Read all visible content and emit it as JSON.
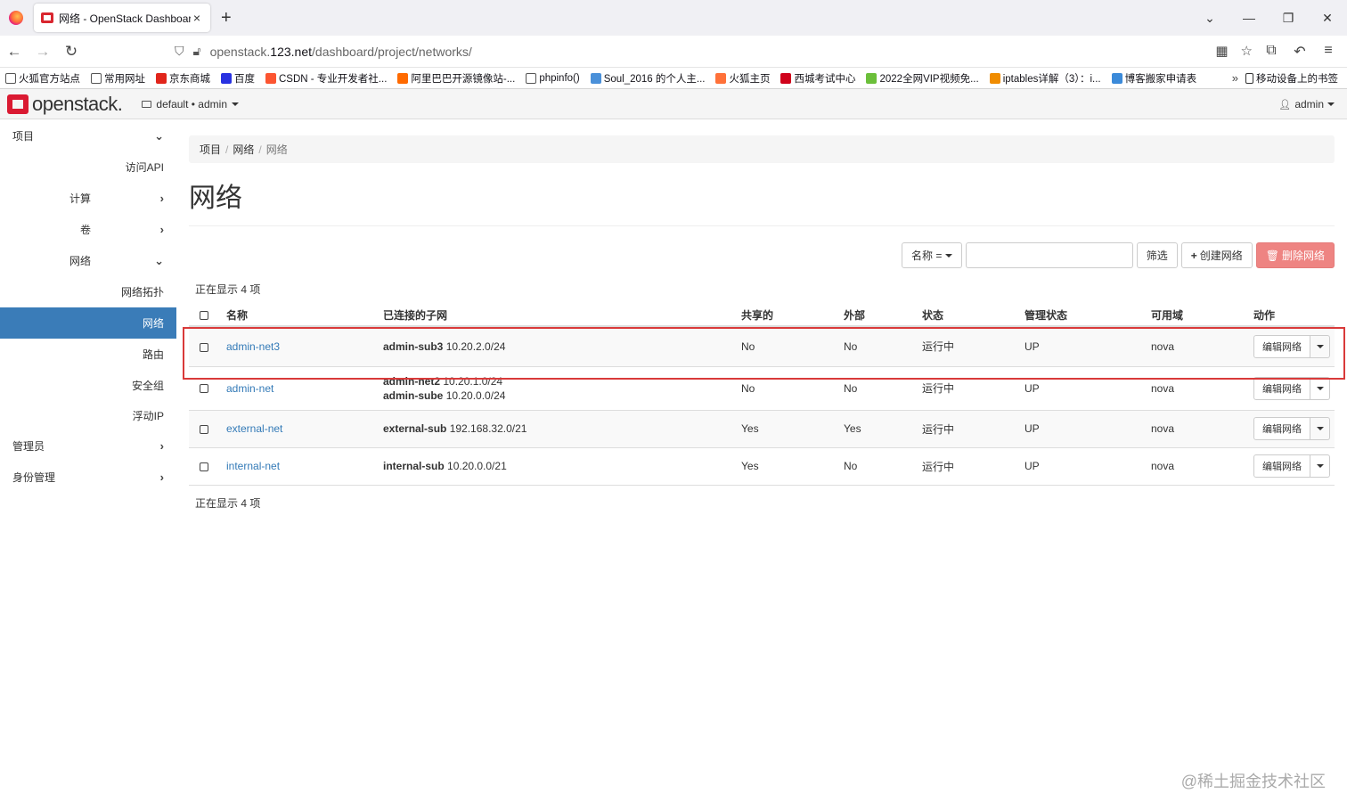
{
  "browser": {
    "tab_title": "网络 - OpenStack Dashboard",
    "url_prefix": "openstack.",
    "url_domain": "123.net",
    "url_path": "/dashboard/project/networks/"
  },
  "bookmarks": [
    {
      "label": "火狐官方站点",
      "color": "#ffffff"
    },
    {
      "label": "常用网址",
      "color": "#ffffff"
    },
    {
      "label": "京东商城",
      "color": "#e1251b"
    },
    {
      "label": "百度",
      "color": "#2932e1"
    },
    {
      "label": "CSDN - 专业开发者社...",
      "color": "#fc5531"
    },
    {
      "label": "阿里巴巴开源镜像站-...",
      "color": "#ff6a00"
    },
    {
      "label": "phpinfo()",
      "color": "#ffffff"
    },
    {
      "label": "Soul_2016 的个人主...",
      "color": "#4a90d9"
    },
    {
      "label": "火狐主页",
      "color": "#ff7139"
    },
    {
      "label": "西城考试中心",
      "color": "#d0021b"
    },
    {
      "label": "2022全网VIP视频免...",
      "color": "#6bbf3a"
    },
    {
      "label": "iptables详解（3）：i...",
      "color": "#f08c00"
    },
    {
      "label": "博客搬家申请表",
      "color": "#3b8ad9"
    }
  ],
  "bookmarks_more": "移动设备上的书签",
  "header": {
    "logo_text": "openstack.",
    "project": "default • admin",
    "user": "admin"
  },
  "sidebar": {
    "project": "项目",
    "api": "访问API",
    "compute": "计算",
    "volume": "卷",
    "network": "网络",
    "topology": "网络拓扑",
    "networks": "网络",
    "routers": "路由",
    "security_groups": "安全组",
    "floating_ip": "浮动IP",
    "admin": "管理员",
    "identity": "身份管理"
  },
  "breadcrumb": [
    "项目",
    "网络",
    "网络"
  ],
  "page_title": "网络",
  "toolbar": {
    "filter_field": "名称 =",
    "filter_btn": "筛选",
    "create_btn": "创建网络",
    "delete_btn": "删除网络"
  },
  "count_text": "正在显示 4 项",
  "table": {
    "headers": [
      "名称",
      "已连接的子网",
      "共享的",
      "外部",
      "状态",
      "管理状态",
      "可用域",
      "动作"
    ],
    "rows": [
      {
        "name": "admin-net3",
        "subnets": [
          {
            "name": "admin-sub3",
            "cidr": "10.20.2.0/24"
          }
        ],
        "shared": "No",
        "external": "No",
        "status": "运行中",
        "admin_state": "UP",
        "zone": "nova",
        "action": "编辑网络"
      },
      {
        "name": "admin-net",
        "subnets": [
          {
            "name": "admin-net2",
            "cidr": "10.20.1.0/24"
          },
          {
            "name": "admin-sube",
            "cidr": "10.20.0.0/24"
          }
        ],
        "shared": "No",
        "external": "No",
        "status": "运行中",
        "admin_state": "UP",
        "zone": "nova",
        "action": "编辑网络"
      },
      {
        "name": "external-net",
        "subnets": [
          {
            "name": "external-sub",
            "cidr": "192.168.32.0/21"
          }
        ],
        "shared": "Yes",
        "external": "Yes",
        "status": "运行中",
        "admin_state": "UP",
        "zone": "nova",
        "action": "编辑网络"
      },
      {
        "name": "internal-net",
        "subnets": [
          {
            "name": "internal-sub",
            "cidr": "10.20.0.0/21"
          }
        ],
        "shared": "Yes",
        "external": "No",
        "status": "运行中",
        "admin_state": "UP",
        "zone": "nova",
        "action": "编辑网络"
      }
    ]
  },
  "watermark": "@稀土掘金技术社区"
}
